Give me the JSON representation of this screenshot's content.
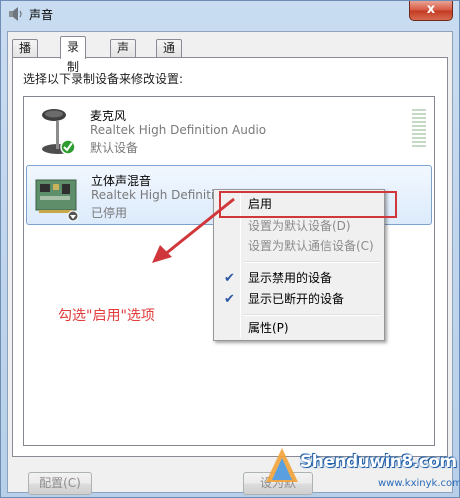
{
  "window": {
    "title": "声音",
    "close_label": "x"
  },
  "tabs": [
    {
      "label": "播放",
      "active": false
    },
    {
      "label": "录制",
      "active": true
    },
    {
      "label": "声音",
      "active": false
    },
    {
      "label": "通信",
      "active": false
    }
  ],
  "instruction": "选择以下录制设备来修改设置:",
  "devices": [
    {
      "name": "麦克风",
      "description": "Realtek High Definition Audio",
      "status": "默认设备",
      "icon": "microphone-icon"
    },
    {
      "name": "立体声混音",
      "description": "Realtek High Definition Audio",
      "status": "已停用",
      "icon": "sound-card-icon"
    }
  ],
  "context_menu": {
    "items": [
      {
        "label": "启用",
        "enabled": true,
        "checked": false
      },
      {
        "label": "设置为默认设备(D)",
        "enabled": false,
        "checked": false
      },
      {
        "label": "设置为默认通信设备(C)",
        "enabled": false,
        "checked": false
      },
      {
        "label": "显示禁用的设备",
        "enabled": true,
        "checked": true
      },
      {
        "label": "显示已断开的设备",
        "enabled": true,
        "checked": true
      },
      {
        "label": "属性(P)",
        "enabled": true,
        "checked": false
      }
    ]
  },
  "annotation": {
    "text": "勾选\"启用\"选项",
    "color": "#e23b3b"
  },
  "buttons": {
    "configure": "配置(C)",
    "set_default": "设为默"
  },
  "watermark": {
    "text": "Shenduwin8.com",
    "url": "www.kxinyk.com"
  },
  "colors": {
    "accent": "#2b56a6",
    "annotation": "#d0373a",
    "close": "#c23a22"
  }
}
